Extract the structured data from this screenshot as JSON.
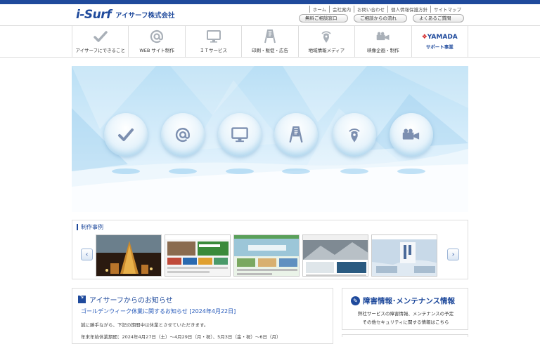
{
  "header": {
    "logo_mark": "i-Surf",
    "logo_name": "アイサーフ株式会社",
    "util_links": [
      "ホーム",
      "会社案内",
      "お問い合わせ",
      "個人情報保護方針",
      "サイトマップ"
    ],
    "buttons": [
      "無料ご相談窓口",
      "ご相談からの流れ",
      "よくあるご質問"
    ]
  },
  "nav": {
    "items": [
      {
        "label": "アイサーフにできること",
        "icon": "check-icon"
      },
      {
        "label": "WEB サイト制作",
        "icon": "at-icon"
      },
      {
        "label": "ＩＴサービス",
        "icon": "monitor-icon"
      },
      {
        "label": "印刷・販促・広告",
        "icon": "easel-icon"
      },
      {
        "label": "地域情報メディア",
        "icon": "location-signal-icon"
      },
      {
        "label": "映像企画・制作",
        "icon": "video-camera-icon"
      }
    ],
    "yamada": {
      "brand": "YAMADA",
      "label": "サポート事業"
    }
  },
  "hero": {
    "icons": [
      "check-icon",
      "at-icon",
      "monitor-icon",
      "easel-icon",
      "location-signal-icon",
      "video-camera-icon"
    ]
  },
  "works": {
    "title": "制作事例",
    "prev": "‹",
    "next": "›"
  },
  "news": {
    "title": "アイサーフからのお知らせ",
    "link": "ゴールデンウィーク休業に関するお知らせ [2024年4月22日]",
    "body": "誠に勝手ながら、下記の期間中は休業とさせていただきます。",
    "body2": "年末年始休業期間：2024年4月27日（土）～4月29日（月・祝）、5月3日（金・祝）～6日（月）"
  },
  "maintenance": {
    "title": "障害情報･メンテナンス情報",
    "line1": "弊社サービスの障害情報、メンテナンスの予定",
    "line2": "その他セキュリティに関する情報はこちら"
  },
  "colors": {
    "brand": "#1f4a9c",
    "link": "#2055b8"
  }
}
